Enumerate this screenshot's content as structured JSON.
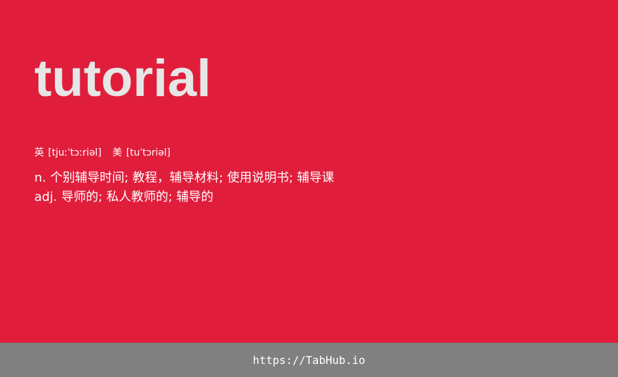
{
  "card": {
    "word": "tutorial",
    "phonetics": {
      "uk_label": "英",
      "uk_ipa": "[tjuːˈtɔːriəl]",
      "us_label": "美",
      "us_ipa": "[tuˈtɔriəl]"
    },
    "definitions": [
      {
        "pos": "n.",
        "meaning": "个别辅导时间; 教程，辅导材料; 使用说明书; 辅导课"
      },
      {
        "pos": "adj.",
        "meaning": "导师的; 私人教师的; 辅导的"
      }
    ]
  },
  "footer": {
    "link_text": "https://TabHub.io"
  },
  "colors": {
    "background": "#e01e3c",
    "word": "#e6e6e6",
    "text": "#ffffff",
    "footer": "#808080"
  }
}
